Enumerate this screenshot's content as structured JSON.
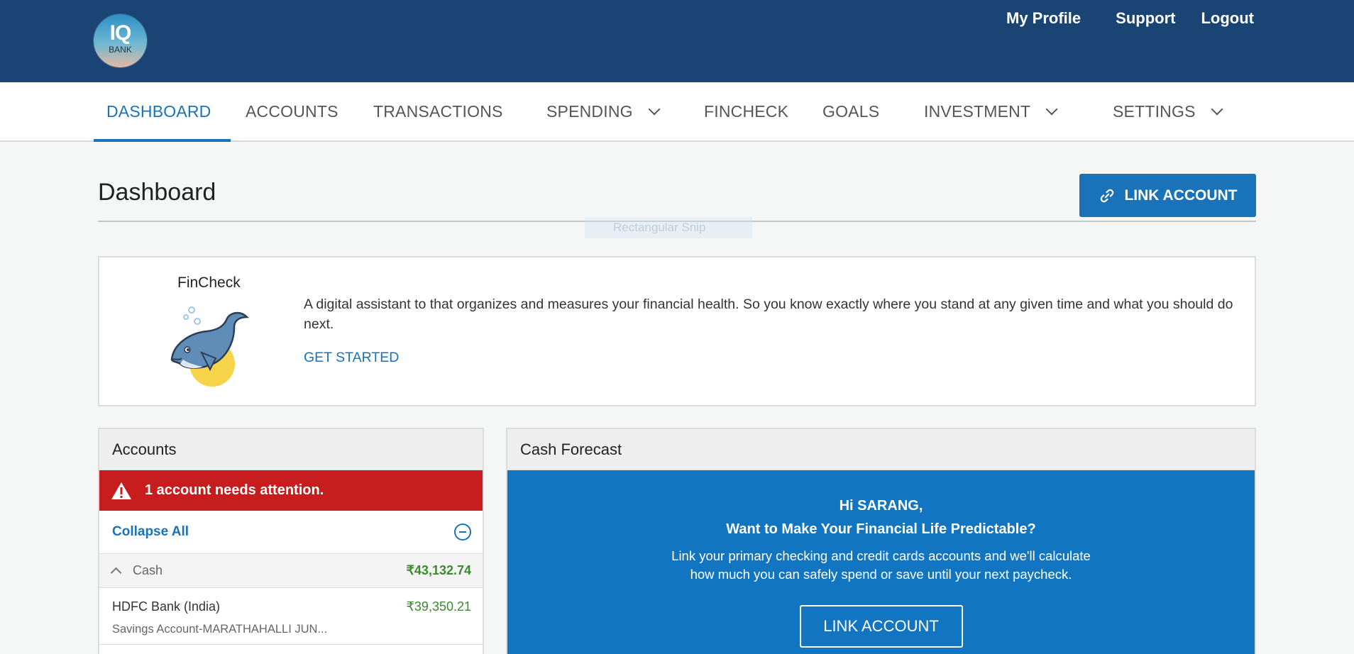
{
  "brand": {
    "logo_main": "IQ",
    "logo_sub": "BANK"
  },
  "header_links": {
    "profile": "My Profile",
    "support": "Support",
    "logout": "Logout"
  },
  "nav": {
    "dashboard": "DASHBOARD",
    "accounts": "ACCOUNTS",
    "transactions": "TRANSACTIONS",
    "spending": "SPENDING",
    "fincheck": "FINCHECK",
    "goals": "GOALS",
    "investment": "INVESTMENT",
    "settings": "SETTINGS"
  },
  "page": {
    "title": "Dashboard",
    "link_account": "LINK ACCOUNT",
    "snip_overlay": "Rectangular Snip"
  },
  "fincheck": {
    "title": "FinCheck",
    "description": "A digital assistant to that organizes and measures your financial health. So you know exactly where you stand at any given time and what you should do next.",
    "cta": "GET STARTED"
  },
  "accounts": {
    "title": "Accounts",
    "alert": "1 account needs attention.",
    "collapse": "Collapse All",
    "cash_label": "Cash",
    "cash_total": "₹43,132.74",
    "bank_name": "HDFC Bank (India)",
    "bank_amount": "₹39,350.21",
    "bank_sub": "Savings Account-MARATHAHALLI JUN..."
  },
  "forecast": {
    "title": "Cash Forecast",
    "greeting": "Hi SARANG,",
    "question": "Want to Make Your Financial Life Predictable?",
    "line1": "Link your primary checking and credit cards accounts and we'll calculate",
    "line2": "how much you can safely spend or save until your next paycheck.",
    "button": "LINK ACCOUNT"
  },
  "colors": {
    "topbar": "#1a4474",
    "accent": "#1a73b9",
    "alert": "#c81d1e",
    "positive": "#3b8a2e",
    "forecast_bg": "#1275c2"
  }
}
